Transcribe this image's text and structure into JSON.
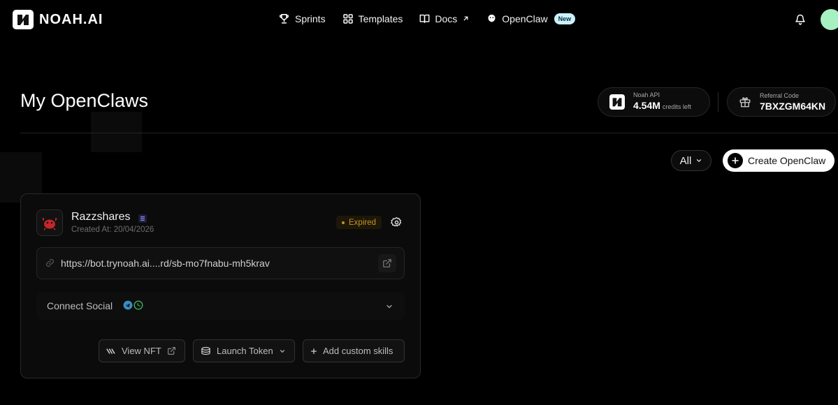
{
  "nav": {
    "brand": "NOAH.AI",
    "links": [
      {
        "label": "Sprints",
        "icon": "trophy-icon"
      },
      {
        "label": "Templates",
        "icon": "grid-icon"
      },
      {
        "label": "Docs",
        "icon": "book-icon"
      },
      {
        "label": "OpenClaw",
        "icon": "claw-icon"
      }
    ],
    "new_badge": "New"
  },
  "header": {
    "title": "My OpenClaws",
    "api": {
      "label": "Noah API",
      "value": "4.54M",
      "sub": "credits left"
    },
    "referral": {
      "label": "Referral Code",
      "value": "7BXZGM64KN"
    }
  },
  "toolbar": {
    "filter_value": "All",
    "create_label": "Create OpenClaw"
  },
  "card": {
    "name": "Razzshares",
    "created": "Created At: 20/04/2026",
    "status": "Expired",
    "url": "https://bot.trynoah.ai....rd/sb-mo7fnabu-mh5krav",
    "connect_label": "Connect Social",
    "buttons": {
      "nft": "View NFT",
      "token": "Launch Token",
      "skills": "Add custom skills"
    }
  },
  "colors": {
    "background": "#000000",
    "status_expired": "#c6932a",
    "avatar": "#a6f0c2",
    "badge_new": "#c9f3ff"
  }
}
